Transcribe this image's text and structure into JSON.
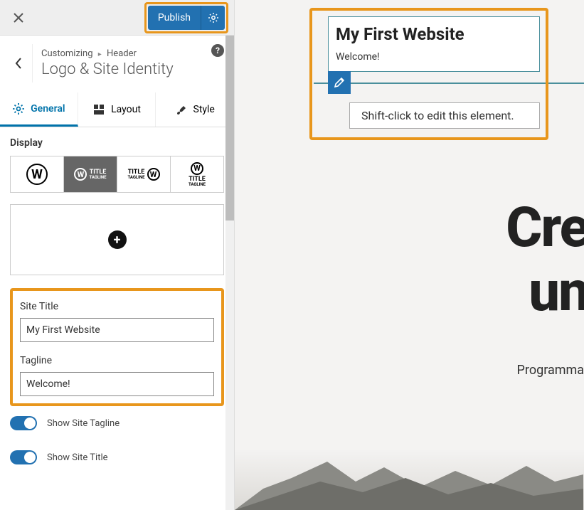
{
  "topbar": {
    "publish_label": "Publish"
  },
  "breadcrumb": {
    "prefix": "Customizing",
    "parent": "Header",
    "title": "Logo & Site Identity"
  },
  "tabs": {
    "general": "General",
    "layout": "Layout",
    "style": "Style"
  },
  "display": {
    "label": "Display",
    "opt2_title": "TITLE",
    "opt2_tag": "TAGLINE",
    "opt3_title": "TITLE",
    "opt3_tag": "TAGLINE",
    "opt4_title": "TITLE",
    "opt4_tag": "TAGLINE"
  },
  "fields": {
    "site_title_label": "Site Title",
    "site_title_value": "My First Website",
    "tagline_label": "Tagline",
    "tagline_value": "Welcome!"
  },
  "toggles": {
    "show_tagline": "Show Site Tagline",
    "show_title": "Show Site Title"
  },
  "preview": {
    "title": "My First Website",
    "tagline": "Welcome!",
    "tooltip": "Shift-click to edit this element.",
    "big_line1": "Cre",
    "big_line2": "un",
    "sub": "Programmat"
  }
}
